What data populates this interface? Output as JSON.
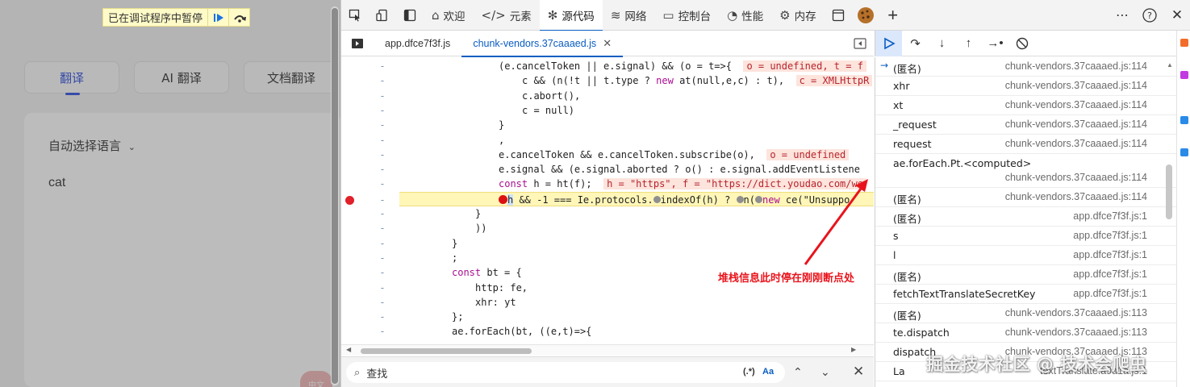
{
  "webpage": {
    "paused_banner": "已在调试程序中暂停",
    "tabs": [
      {
        "label": "翻译",
        "active": true
      },
      {
        "label": "AI 翻译",
        "active": false
      },
      {
        "label": "文档翻译",
        "active": false
      }
    ],
    "source_lang": "自动选择语言",
    "input_text": "cat",
    "float_btn": "中文"
  },
  "devtools": {
    "tabs": [
      {
        "label": "欢迎",
        "icon": "home-icon",
        "active": false
      },
      {
        "label": "元素",
        "icon": "code-brackets-icon",
        "active": false
      },
      {
        "label": "源代码",
        "icon": "bug-icon",
        "active": true
      },
      {
        "label": "网络",
        "icon": "wifi-icon",
        "active": false
      },
      {
        "label": "控制台",
        "icon": "terminal-icon",
        "active": false
      },
      {
        "label": "性能",
        "icon": "gauge-icon",
        "active": false
      },
      {
        "label": "内存",
        "icon": "gear-chip-icon",
        "active": false
      }
    ],
    "file_tabs": [
      {
        "label": "app.dfce7f3f.js",
        "active": false
      },
      {
        "label": "chunk-vendors.37caaaed.js",
        "active": true
      }
    ],
    "code_lines": [
      {
        "text": "(e.cancelToken || e.signal) && (o = t=>{",
        "annot": "o = undefined, t = f",
        "indent": 16
      },
      {
        "text": "c && (n(!t || t.type ? new at(null,e,c) : t),",
        "annot": "c = XMLHttpR",
        "indent": 20
      },
      {
        "text": "c.abort(),",
        "annot": "",
        "indent": 20
      },
      {
        "text": "c = null)",
        "annot": "",
        "indent": 20
      },
      {
        "text": "}",
        "annot": "",
        "indent": 16
      },
      {
        "text": ",",
        "annot": "",
        "indent": 16
      },
      {
        "text": "e.cancelToken && e.cancelToken.subscribe(o),",
        "annot": "o = undefined",
        "indent": 16
      },
      {
        "text": "e.signal && (e.signal.aborted ? o() : e.signal.addEventListene",
        "annot": "",
        "indent": 16
      },
      {
        "text": "const h = ht(f);",
        "annot": "h = \"https\", f = \"https://dict.youdao.com/we",
        "indent": 16
      },
      {
        "text": "h && -1 === Ie.protocols.",
        "annot": "",
        "indent": 16,
        "highlight": true
      },
      {
        "text": "}",
        "annot": "",
        "indent": 12
      },
      {
        "text": "))",
        "annot": "",
        "indent": 12
      },
      {
        "text": "}",
        "annot": "",
        "indent": 8
      },
      {
        "text": ";",
        "annot": "",
        "indent": 8
      },
      {
        "text": "const bt = {",
        "annot": "",
        "indent": 8
      },
      {
        "text": "http: fe,",
        "annot": "",
        "indent": 12
      },
      {
        "text": "xhr: yt",
        "annot": "",
        "indent": 12
      },
      {
        "text": "};",
        "annot": "",
        "indent": 8
      },
      {
        "text": "ae.forEach(bt, ((e,t)=>{",
        "annot": "",
        "indent": 8
      }
    ],
    "highlight_tail": "indexOf(h) ? ",
    "highlight_tail2": "n(",
    "highlight_tail3": "new ce(\"Unsuppo",
    "search": {
      "placeholder": "查找",
      "regex": "(.*)",
      "case": "Aa"
    },
    "call_stack": [
      {
        "fn": "(匿名)",
        "loc": "chunk-vendors.37caaaed.js:114",
        "current": true
      },
      {
        "fn": "xhr",
        "loc": "chunk-vendors.37caaaed.js:114"
      },
      {
        "fn": "xt",
        "loc": "chunk-vendors.37caaaed.js:114"
      },
      {
        "fn": "_request",
        "loc": "chunk-vendors.37caaaed.js:114"
      },
      {
        "fn": "request",
        "loc": "chunk-vendors.37caaaed.js:114"
      },
      {
        "fn": "ae.forEach.Pt.<computed>",
        "loc": "chunk-vendors.37caaaed.js:114",
        "tall": true
      },
      {
        "fn": "(匿名)",
        "loc": "chunk-vendors.37caaaed.js:114"
      },
      {
        "fn": "(匿名)",
        "loc": "app.dfce7f3f.js:1"
      },
      {
        "fn": "s",
        "loc": "app.dfce7f3f.js:1"
      },
      {
        "fn": "l",
        "loc": "app.dfce7f3f.js:1"
      },
      {
        "fn": "(匿名)",
        "loc": "app.dfce7f3f.js:1"
      },
      {
        "fn": "fetchTextTranslateSecretKey",
        "loc": "app.dfce7f3f.js:1"
      },
      {
        "fn": "(匿名)",
        "loc": "chunk-vendors.37caaaed.js:113"
      },
      {
        "fn": "te.dispatch",
        "loc": "chunk-vendors.37caaaed.js:113"
      },
      {
        "fn": "dispatch",
        "loc": "chunk-vendors.37caaaed.js:113"
      },
      {
        "fn": "La",
        "loc": "textTranslate.a9a1a.js:1"
      }
    ]
  },
  "annotation": "堆栈信息此时停在刚刚断点处",
  "watermark": "掘金技术社区 @ 技术会爬虫",
  "colors": {
    "accent": "#0a5dc2",
    "breakpoint": "#e0202a",
    "annotation": "#e8141c",
    "highlight_line": "#fff6b8"
  }
}
